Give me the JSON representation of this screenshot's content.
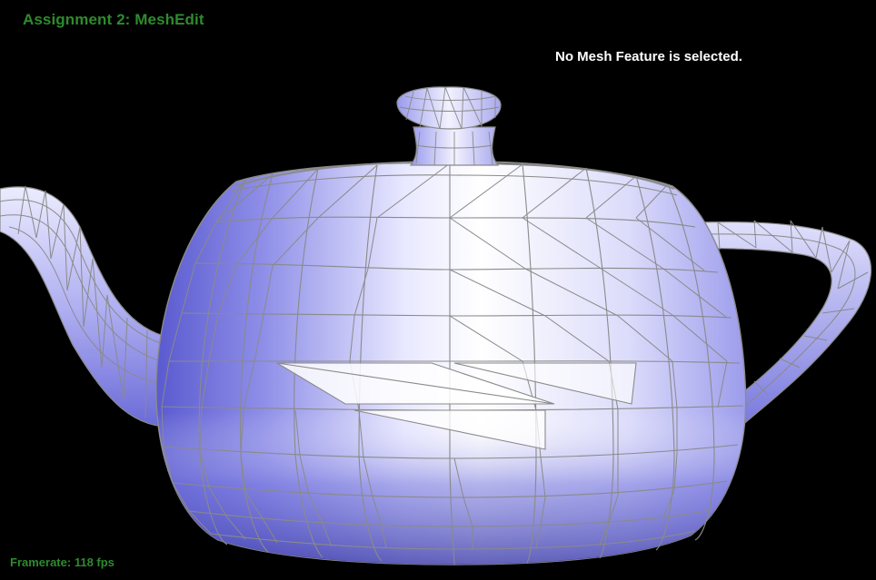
{
  "app": {
    "title": "Assignment 2: MeshEdit"
  },
  "status": {
    "message": "No Mesh Feature is selected."
  },
  "stats": {
    "framerate_label": "Framerate:",
    "framerate_value": "118 fps"
  },
  "colors": {
    "background": "#000000",
    "title_green": "#2e8b2e",
    "mesh_fill_light": "#f4f4ff",
    "mesh_fill_mid": "#b8b8f6",
    "mesh_fill_dark": "#6262d8",
    "wireframe": "#8a8a8a"
  }
}
